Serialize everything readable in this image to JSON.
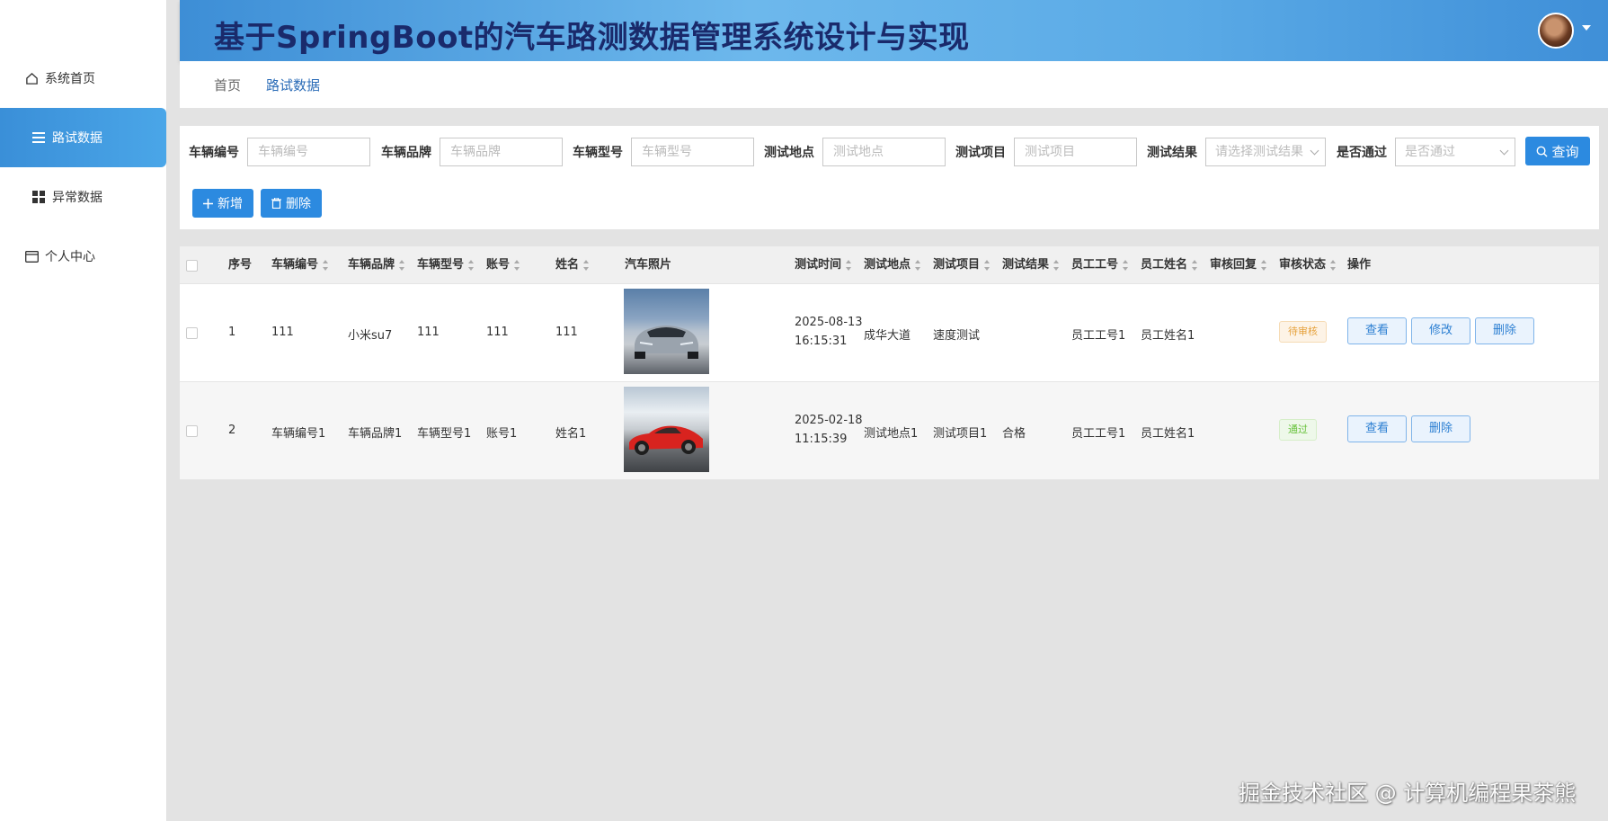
{
  "sidebar": {
    "items": [
      {
        "label": "系统首页",
        "icon": "home-icon"
      },
      {
        "label": "路试数据",
        "icon": "list-icon",
        "active": true
      },
      {
        "label": "异常数据",
        "icon": "grid-icon"
      },
      {
        "label": "个人中心",
        "icon": "card-icon"
      }
    ]
  },
  "header": {
    "title": "基于SpringBoot的汽车路测数据管理系统设计与实现"
  },
  "breadcrumb": {
    "home": "首页",
    "current": "路试数据"
  },
  "search": {
    "fields": [
      {
        "label": "车辆编号",
        "placeholder": "车辆编号"
      },
      {
        "label": "车辆品牌",
        "placeholder": "车辆品牌"
      },
      {
        "label": "车辆型号",
        "placeholder": "车辆型号"
      },
      {
        "label": "测试地点",
        "placeholder": "测试地点"
      },
      {
        "label": "测试项目",
        "placeholder": "测试项目"
      }
    ],
    "result_label": "测试结果",
    "result_placeholder": "请选择测试结果",
    "pass_label": "是否通过",
    "pass_placeholder": "是否通过",
    "query_button": "查询",
    "add_button": "新增",
    "delete_button": "删除"
  },
  "table": {
    "headers": [
      "序号",
      "车辆编号",
      "车辆品牌",
      "车辆型号",
      "账号",
      "姓名",
      "汽车照片",
      "测试时间",
      "测试地点",
      "测试项目",
      "测试结果",
      "员工工号",
      "员工姓名",
      "审核回复",
      "审核状态",
      "操作"
    ],
    "rows": [
      {
        "index": "1",
        "vehicle_no": "111",
        "brand": "小米su7",
        "model": "111",
        "account": "111",
        "name": "111",
        "date": "2025-08-13",
        "time": "16:15:31",
        "location": "成华大道",
        "item": "速度测试",
        "result": "",
        "emp_no": "员工工号1",
        "emp_name": "员工姓名1",
        "reply": "",
        "status": "待审核",
        "actions": [
          "查看",
          "修改",
          "删除"
        ]
      },
      {
        "index": "2",
        "vehicle_no": "车辆编号1",
        "brand": "车辆品牌1",
        "model": "车辆型号1",
        "account": "账号1",
        "name": "姓名1",
        "date": "2025-02-18",
        "time": "11:15:39",
        "location": "测试地点1",
        "item": "测试项目1",
        "result": "合格",
        "emp_no": "员工工号1",
        "emp_name": "员工姓名1",
        "reply": "",
        "status": "通过",
        "actions": [
          "查看",
          "删除"
        ]
      }
    ]
  },
  "watermark": "掘金技术社区 @ 计算机编程果茶熊",
  "colors": {
    "primary": "#2c8ae0",
    "sidebar_active": "#3a8fd8",
    "title": "#1a2a6b",
    "pending": "#e6a23c",
    "passed": "#67c23a"
  }
}
